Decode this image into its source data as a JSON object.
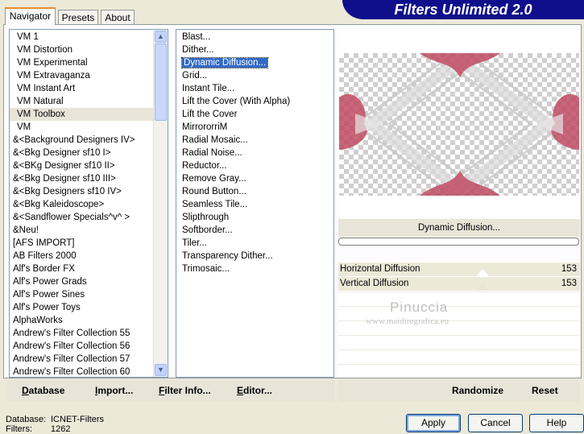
{
  "header": {
    "title": "Filters Unlimited 2.0"
  },
  "tabs": [
    {
      "label": "Navigator",
      "active": true
    },
    {
      "label": "Presets",
      "active": false
    },
    {
      "label": "About",
      "active": false
    }
  ],
  "categories": {
    "items": [
      "VM 1",
      "VM Distortion",
      "VM Experimental",
      "VM Extravaganza",
      "VM Instant Art",
      "VM Natural",
      "VM Toolbox",
      "VM",
      "&<Background Designers IV>",
      "&<Bkg Designer sf10 I>",
      "&<BKg Designer sf10 II>",
      "&<Bkg Designer sf10 III>",
      "&<Bkg Designers sf10 IV>",
      "&<Bkg Kaleidoscope>",
      "&<Sandflower Specials^v^ >",
      "&Neu!",
      "[AFS IMPORT]",
      "AB Filters 2000",
      "Alf's Border FX",
      "Alf's Power Grads",
      "Alf's Power Sines",
      "Alf's Power Toys",
      "AlphaWorks",
      "Andrew's Filter Collection 55",
      "Andrew's Filter Collection 56",
      "Andrew's Filter Collection 57",
      "Andrew's Filter Collection 60"
    ],
    "selected": "VM Toolbox"
  },
  "filters": {
    "items": [
      "Blast...",
      "Dither...",
      "Dynamic Diffusion...",
      "Grid...",
      "Instant Tile...",
      "Lift the Cover (With Alpha)",
      "Lift the Cover",
      "MirrororriM",
      "Radial Mosaic...",
      "Radial Noise...",
      "Reductor...",
      "Remove Gray...",
      "Round Button...",
      "Seamless Tile...",
      "Slipthrough",
      "Softborder...",
      "Tiler...",
      "Transparency Dither...",
      "Trimosaic..."
    ],
    "selected": "Dynamic Diffusion..."
  },
  "preview": {
    "filter_name": "Dynamic Diffusion...",
    "progress": 0,
    "accent_color": "#c04b62"
  },
  "params": [
    {
      "name": "Horizontal Diffusion",
      "value": "153"
    },
    {
      "name": "Vertical Diffusion",
      "value": "153"
    }
  ],
  "watermark": {
    "line1": "Pinuccia",
    "line2": "www.maidiregrafica.eu"
  },
  "toolbar": {
    "database": "Database",
    "import": "Import...",
    "filter_info": "Filter Info...",
    "editor": "Editor...",
    "randomize": "Randomize",
    "reset": "Reset"
  },
  "status": {
    "database_label": "Database:",
    "database_value": "ICNET-Filters",
    "filters_label": "Filters:",
    "filters_value": "1262"
  },
  "buttons": {
    "apply": "Apply",
    "cancel": "Cancel",
    "help": "Help"
  },
  "colors": {
    "title_bar": "#0f0f8c",
    "selection": "#316ac5",
    "panel": "#ece9d8"
  }
}
